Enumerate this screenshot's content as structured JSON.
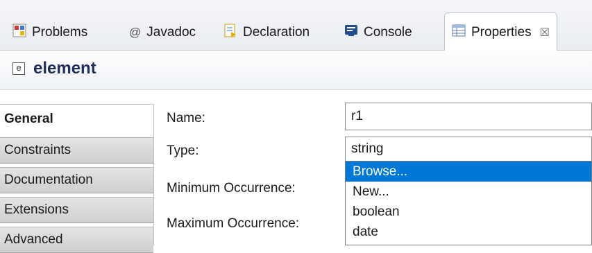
{
  "tabs": [
    {
      "label": "Problems",
      "icon": "problems-icon"
    },
    {
      "label": "Javadoc",
      "icon": "at-icon"
    },
    {
      "label": "Declaration",
      "icon": "declaration-icon"
    },
    {
      "label": "Console",
      "icon": "console-icon"
    },
    {
      "label": "Properties",
      "icon": "properties-icon",
      "active": true,
      "close": "☒"
    }
  ],
  "header": {
    "icon_letter": "e",
    "title": "element"
  },
  "side_tabs": [
    "General",
    "Constraints",
    "Documentation",
    "Extensions",
    "Advanced"
  ],
  "form": {
    "name_label": "Name:",
    "name_value": "r1",
    "type_label": "Type:",
    "type_value": "string",
    "min_label": "Minimum Occurrence:",
    "max_label": "Maximum Occurrence:"
  },
  "dropdown": {
    "options": [
      "Browse...",
      "New...",
      "boolean",
      "date"
    ],
    "selected": "Browse..."
  },
  "colors": {
    "selection": "#0078d7",
    "header_title": "#1f2e5a"
  }
}
